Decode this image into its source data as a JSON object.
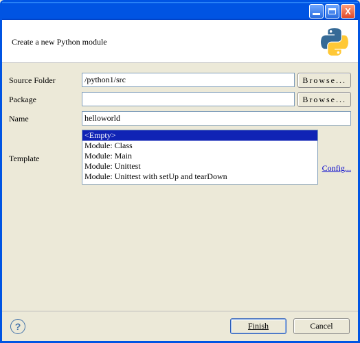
{
  "header": {
    "subtitle": "Create a new Python module"
  },
  "form": {
    "sourceFolder": {
      "label": "Source Folder",
      "value": "/python1/src",
      "browse": "Browse..."
    },
    "package": {
      "label": "Package",
      "value": "",
      "browse": "Browse..."
    },
    "name": {
      "label": "Name",
      "value": "helloworld"
    },
    "template": {
      "label": "Template",
      "items": [
        "<Empty>",
        "Module: Class",
        "Module: Main",
        "Module: Unittest",
        "Module: Unittest with setUp and tearDown"
      ],
      "selectedIndex": 0,
      "configLink": "Config..."
    }
  },
  "footer": {
    "finish": "Finish",
    "cancel": "Cancel"
  }
}
